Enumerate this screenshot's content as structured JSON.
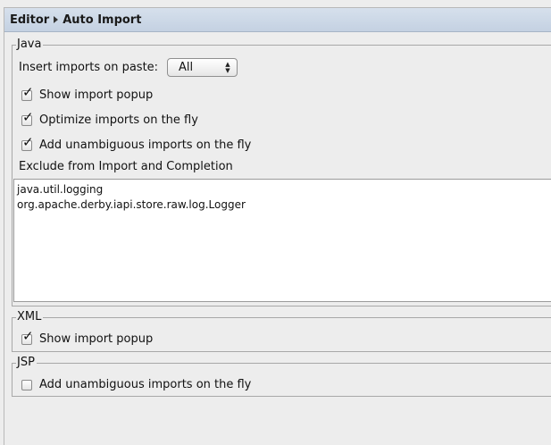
{
  "breadcrumb": {
    "parent": "Editor",
    "current": "Auto Import"
  },
  "java": {
    "title": "Java",
    "insert_label": "Insert imports on paste:",
    "insert_value": "All",
    "show_popup": {
      "label": "Show import popup",
      "checked": true
    },
    "optimize": {
      "label": "Optimize imports on the fly",
      "checked": true
    },
    "add_unambiguous": {
      "label": "Add unambiguous imports on the fly",
      "checked": true
    },
    "exclude_label": "Exclude from Import and Completion",
    "exclude_items": [
      "java.util.logging",
      "org.apache.derby.iapi.store.raw.log.Logger"
    ]
  },
  "xml": {
    "title": "XML",
    "show_popup": {
      "label": "Show import popup",
      "checked": true
    }
  },
  "jsp": {
    "title": "JSP",
    "add_unambiguous": {
      "label": "Add unambiguous imports on the fly",
      "checked": false
    }
  }
}
